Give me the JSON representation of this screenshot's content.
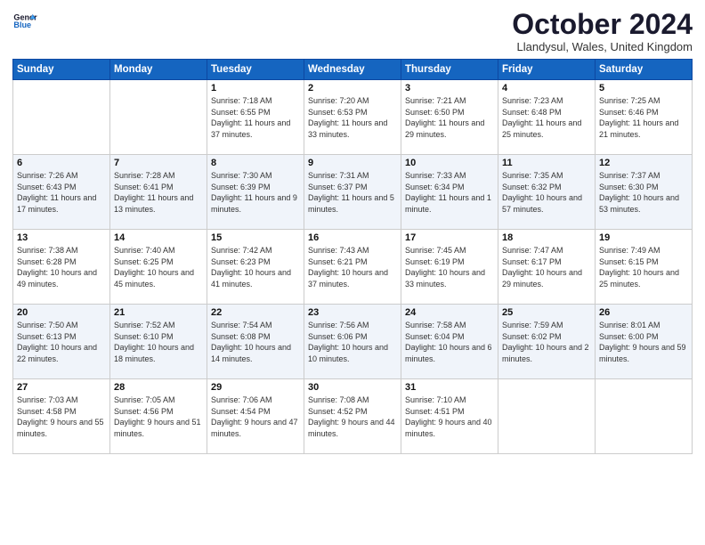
{
  "header": {
    "logo_line1": "General",
    "logo_line2": "Blue",
    "month": "October 2024",
    "location": "Llandysul, Wales, United Kingdom"
  },
  "weekdays": [
    "Sunday",
    "Monday",
    "Tuesday",
    "Wednesday",
    "Thursday",
    "Friday",
    "Saturday"
  ],
  "weeks": [
    [
      {
        "day": "",
        "info": ""
      },
      {
        "day": "",
        "info": ""
      },
      {
        "day": "1",
        "info": "Sunrise: 7:18 AM\nSunset: 6:55 PM\nDaylight: 11 hours and 37 minutes."
      },
      {
        "day": "2",
        "info": "Sunrise: 7:20 AM\nSunset: 6:53 PM\nDaylight: 11 hours and 33 minutes."
      },
      {
        "day": "3",
        "info": "Sunrise: 7:21 AM\nSunset: 6:50 PM\nDaylight: 11 hours and 29 minutes."
      },
      {
        "day": "4",
        "info": "Sunrise: 7:23 AM\nSunset: 6:48 PM\nDaylight: 11 hours and 25 minutes."
      },
      {
        "day": "5",
        "info": "Sunrise: 7:25 AM\nSunset: 6:46 PM\nDaylight: 11 hours and 21 minutes."
      }
    ],
    [
      {
        "day": "6",
        "info": "Sunrise: 7:26 AM\nSunset: 6:43 PM\nDaylight: 11 hours and 17 minutes."
      },
      {
        "day": "7",
        "info": "Sunrise: 7:28 AM\nSunset: 6:41 PM\nDaylight: 11 hours and 13 minutes."
      },
      {
        "day": "8",
        "info": "Sunrise: 7:30 AM\nSunset: 6:39 PM\nDaylight: 11 hours and 9 minutes."
      },
      {
        "day": "9",
        "info": "Sunrise: 7:31 AM\nSunset: 6:37 PM\nDaylight: 11 hours and 5 minutes."
      },
      {
        "day": "10",
        "info": "Sunrise: 7:33 AM\nSunset: 6:34 PM\nDaylight: 11 hours and 1 minute."
      },
      {
        "day": "11",
        "info": "Sunrise: 7:35 AM\nSunset: 6:32 PM\nDaylight: 10 hours and 57 minutes."
      },
      {
        "day": "12",
        "info": "Sunrise: 7:37 AM\nSunset: 6:30 PM\nDaylight: 10 hours and 53 minutes."
      }
    ],
    [
      {
        "day": "13",
        "info": "Sunrise: 7:38 AM\nSunset: 6:28 PM\nDaylight: 10 hours and 49 minutes."
      },
      {
        "day": "14",
        "info": "Sunrise: 7:40 AM\nSunset: 6:25 PM\nDaylight: 10 hours and 45 minutes."
      },
      {
        "day": "15",
        "info": "Sunrise: 7:42 AM\nSunset: 6:23 PM\nDaylight: 10 hours and 41 minutes."
      },
      {
        "day": "16",
        "info": "Sunrise: 7:43 AM\nSunset: 6:21 PM\nDaylight: 10 hours and 37 minutes."
      },
      {
        "day": "17",
        "info": "Sunrise: 7:45 AM\nSunset: 6:19 PM\nDaylight: 10 hours and 33 minutes."
      },
      {
        "day": "18",
        "info": "Sunrise: 7:47 AM\nSunset: 6:17 PM\nDaylight: 10 hours and 29 minutes."
      },
      {
        "day": "19",
        "info": "Sunrise: 7:49 AM\nSunset: 6:15 PM\nDaylight: 10 hours and 25 minutes."
      }
    ],
    [
      {
        "day": "20",
        "info": "Sunrise: 7:50 AM\nSunset: 6:13 PM\nDaylight: 10 hours and 22 minutes."
      },
      {
        "day": "21",
        "info": "Sunrise: 7:52 AM\nSunset: 6:10 PM\nDaylight: 10 hours and 18 minutes."
      },
      {
        "day": "22",
        "info": "Sunrise: 7:54 AM\nSunset: 6:08 PM\nDaylight: 10 hours and 14 minutes."
      },
      {
        "day": "23",
        "info": "Sunrise: 7:56 AM\nSunset: 6:06 PM\nDaylight: 10 hours and 10 minutes."
      },
      {
        "day": "24",
        "info": "Sunrise: 7:58 AM\nSunset: 6:04 PM\nDaylight: 10 hours and 6 minutes."
      },
      {
        "day": "25",
        "info": "Sunrise: 7:59 AM\nSunset: 6:02 PM\nDaylight: 10 hours and 2 minutes."
      },
      {
        "day": "26",
        "info": "Sunrise: 8:01 AM\nSunset: 6:00 PM\nDaylight: 9 hours and 59 minutes."
      }
    ],
    [
      {
        "day": "27",
        "info": "Sunrise: 7:03 AM\nSunset: 4:58 PM\nDaylight: 9 hours and 55 minutes."
      },
      {
        "day": "28",
        "info": "Sunrise: 7:05 AM\nSunset: 4:56 PM\nDaylight: 9 hours and 51 minutes."
      },
      {
        "day": "29",
        "info": "Sunrise: 7:06 AM\nSunset: 4:54 PM\nDaylight: 9 hours and 47 minutes."
      },
      {
        "day": "30",
        "info": "Sunrise: 7:08 AM\nSunset: 4:52 PM\nDaylight: 9 hours and 44 minutes."
      },
      {
        "day": "31",
        "info": "Sunrise: 7:10 AM\nSunset: 4:51 PM\nDaylight: 9 hours and 40 minutes."
      },
      {
        "day": "",
        "info": ""
      },
      {
        "day": "",
        "info": ""
      }
    ]
  ]
}
